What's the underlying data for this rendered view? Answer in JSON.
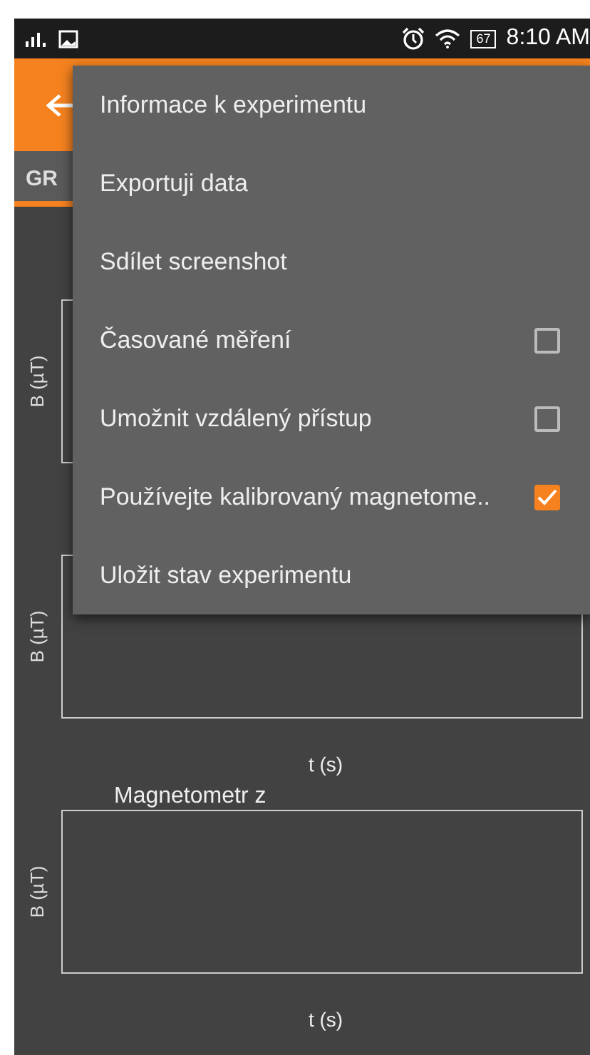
{
  "status_bar": {
    "battery": "67",
    "time": "8:10 AM"
  },
  "tabs": [
    {
      "label": "GR",
      "selected": true
    }
  ],
  "charts": [
    {
      "y_label": "B (µT)"
    },
    {
      "y_label": "B (µT)",
      "x_label": "t (s)"
    },
    {
      "title": "Magnetometr z",
      "y_label": "B (µT)",
      "x_label": "t (s)"
    }
  ],
  "menu": {
    "items": [
      {
        "label": "Informace k experimentu",
        "kind": "plain"
      },
      {
        "label": "Exportuji data",
        "kind": "plain"
      },
      {
        "label": "Sdílet screenshot",
        "kind": "plain"
      },
      {
        "label": "Časované měření",
        "kind": "checkbox",
        "checked": false
      },
      {
        "label": "Umožnit vzdálený přístup",
        "kind": "checkbox",
        "checked": false
      },
      {
        "label": "Používejte kalibrovaný magnetome..",
        "kind": "checkbox",
        "checked": true
      },
      {
        "label": "Uložit stav experimentu",
        "kind": "plain"
      }
    ]
  }
}
